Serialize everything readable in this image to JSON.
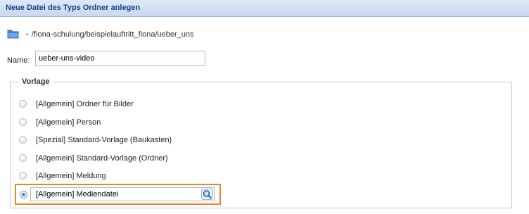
{
  "dialog": {
    "title": "Neue Datei des Typs Ordner anlegen"
  },
  "location": {
    "folder_icon": "folder-icon",
    "bullet": "•",
    "path": "/fiona-schulung/beispielauftritt_fiona/ueber_uns"
  },
  "name_field": {
    "label": "Name:",
    "value": "ueber-uns-video"
  },
  "vorlage": {
    "legend": "Vorlage",
    "options": [
      {
        "label": "[Allgemein] Ordner für Bilder",
        "checked": false
      },
      {
        "label": "[Allgemein] Person",
        "checked": false
      },
      {
        "label": "[Spezial] Standard-Vorlage (Baukasten)",
        "checked": false
      },
      {
        "label": "[Allgemein] Standard-Vorlage (Ordner)",
        "checked": false
      },
      {
        "label": "[Allgemein] Meldung",
        "checked": false
      }
    ],
    "selected": {
      "checked": true,
      "value": "[Allgemein] Mediendatei",
      "search_icon": "magnifier-icon"
    }
  },
  "colors": {
    "title_text": "#15428b",
    "highlight_border": "#e8872a",
    "radio_checked": "#3a6db4"
  }
}
